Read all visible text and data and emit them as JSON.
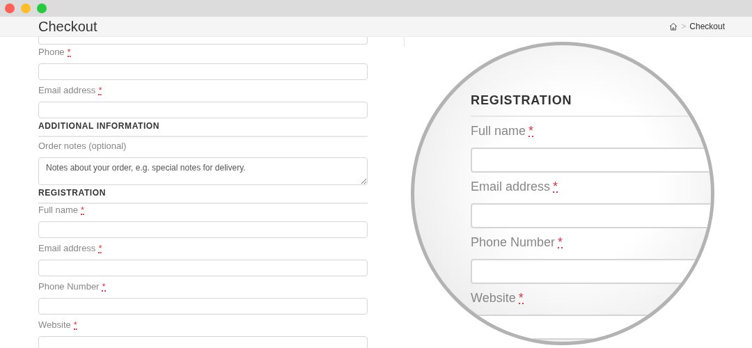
{
  "header": {
    "title": "Checkout",
    "breadcrumb": {
      "separator": ">",
      "current": "Checkout"
    }
  },
  "form": [
    {
      "kind": "input"
    },
    {
      "kind": "field",
      "label": "Phone",
      "mark": "*"
    },
    {
      "kind": "field",
      "label": "Email address",
      "mark": "*"
    },
    {
      "kind": "section",
      "label": "ADDITIONAL INFORMATION"
    },
    {
      "kind": "textarea",
      "label": "Order notes (optional)",
      "placeholder": "Notes about your order, e.g. special notes for delivery."
    },
    {
      "kind": "section",
      "label": "REGISTRATION"
    },
    {
      "kind": "field",
      "label": "Full name",
      "mark": "*"
    },
    {
      "kind": "field",
      "label": "Email address",
      "mark": "*"
    },
    {
      "kind": "field",
      "label": "Phone Number",
      "mark": "*"
    },
    {
      "kind": "field",
      "label": "Website",
      "mark": "*"
    }
  ],
  "magnifier": [
    {
      "kind": "section",
      "label": "REGISTRATION"
    },
    {
      "kind": "field",
      "label": "Full name",
      "mark": "*"
    },
    {
      "kind": "field",
      "label": "Email address",
      "mark": "*"
    },
    {
      "kind": "field",
      "label": "Phone Number",
      "mark": "*"
    },
    {
      "kind": "field",
      "label": "Website",
      "mark": "*"
    }
  ]
}
